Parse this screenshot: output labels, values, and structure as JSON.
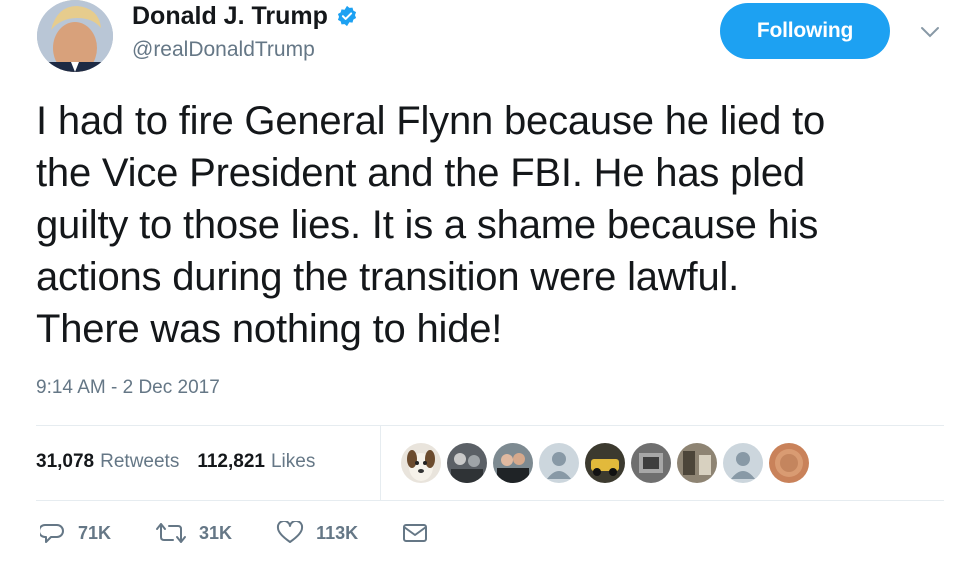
{
  "header": {
    "display_name": "Donald J. Trump",
    "handle": "@realDonaldTrump",
    "follow_label": "Following"
  },
  "tweet": {
    "lines": [
      "I had to fire General Flynn because he lied to",
      "the Vice President and the FBI. He has pled",
      "guilty to those lies. It is a shame because his",
      "actions during the transition were lawful.",
      "There was nothing to hide!"
    ],
    "timestamp": "9:14 AM - 2 Dec 2017"
  },
  "stats": {
    "retweets_count": "31,078",
    "retweets_label": "Retweets",
    "likes_count": "112,821",
    "likes_label": "Likes"
  },
  "likers": [
    {
      "icon": "dog-avatar"
    },
    {
      "icon": "group-avatar"
    },
    {
      "icon": "couple-avatar"
    },
    {
      "icon": "default-avatar"
    },
    {
      "icon": "car-avatar"
    },
    {
      "icon": "photo-avatar"
    },
    {
      "icon": "street-avatar"
    },
    {
      "icon": "default-avatar"
    },
    {
      "icon": "coin-avatar"
    }
  ],
  "actions": {
    "reply_count": "71K",
    "retweet_count": "31K",
    "like_count": "113K"
  },
  "colors": {
    "accent": "#1da1f2",
    "text": "#14171a",
    "secondary": "#657786",
    "divider": "#e6ecf0"
  }
}
